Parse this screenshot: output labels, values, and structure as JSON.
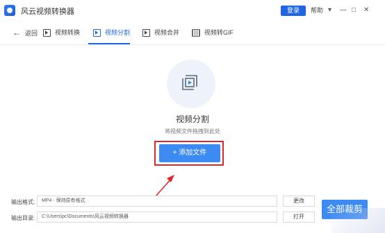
{
  "app": {
    "title": "风云视频转换器"
  },
  "titlebar": {
    "login_label": "登录",
    "help_label": "帮助",
    "icons": [
      "menu-icon",
      "minimize-icon",
      "maximize-icon",
      "close-icon"
    ]
  },
  "nav": {
    "back_label": "返回",
    "tabs": [
      {
        "label": "视频转换"
      },
      {
        "label": "视频分割"
      },
      {
        "label": "视频合并"
      },
      {
        "label": "视频转GIF"
      }
    ],
    "active_index": 1
  },
  "main": {
    "title": "视频分割",
    "hint": "将视频文件拖拽到此处",
    "add_button_label": "+ 添加文件"
  },
  "form": {
    "format_label": "输出格式:",
    "format_value": "MP4 - 保持原有格式",
    "dir_label": "输出目录:",
    "dir_value": "C:\\Users\\pc\\Documents\\风云视频转换器",
    "change_label": "更改",
    "open_label": "打开",
    "cut_all_label": "全部裁剪"
  },
  "colors": {
    "accent": "#1f66e5",
    "button": "#3d8bf2",
    "highlight": "#e0262b"
  }
}
